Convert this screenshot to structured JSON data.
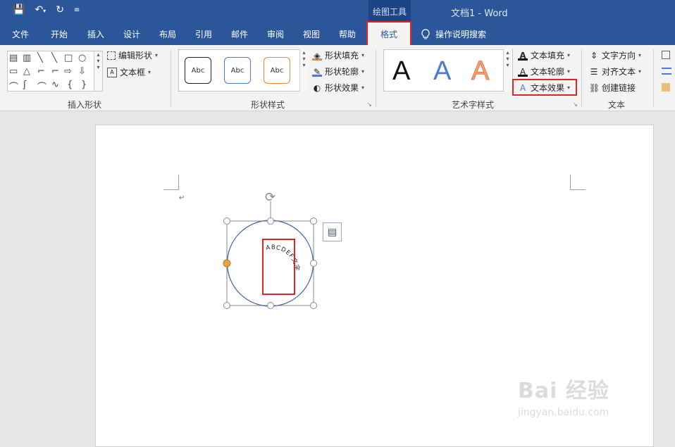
{
  "titlebar": {
    "context_label": "绘图工具",
    "doc_title": "文档1  -  Word",
    "qat": {
      "save": "💾",
      "undo": "↶",
      "undo_caret": "▾",
      "redo": "↻",
      "customize": "≡"
    }
  },
  "tabs": [
    "文件",
    "开始",
    "插入",
    "设计",
    "布局",
    "引用",
    "邮件",
    "审阅",
    "视图",
    "帮助"
  ],
  "active_tab": "格式",
  "search": {
    "label": "操作说明搜索"
  },
  "groups": {
    "insert_shapes": {
      "label": "插入形状",
      "edit_shape": "编辑形状",
      "text_box": "文本框"
    },
    "shape_styles": {
      "label": "形状样式",
      "fill": "形状填充",
      "outline": "形状轮廓",
      "effects": "形状效果",
      "samples": [
        "Abc",
        "Abc",
        "Abc"
      ]
    },
    "wordart_styles": {
      "label": "艺术字样式",
      "text_fill": "文本填充",
      "text_outline": "文本轮廓",
      "text_effects": "文本效果",
      "letters": [
        "A",
        "A",
        "A"
      ]
    },
    "text": {
      "label": "文本",
      "direction": "文字方向",
      "align": "对齐文本",
      "link": "创建链接"
    }
  },
  "shape_glyphs": [
    "▤",
    "▥",
    "╲",
    "╲",
    "□",
    "○",
    "▭",
    "△",
    "⌐",
    "⌐",
    "⇨",
    "⇩",
    "⌒",
    "ʃ",
    "⌒",
    "∿",
    "{",
    "}",
    "☆"
  ],
  "canvas": {
    "curved_text": "ABCDEF文字",
    "paragraph_mark": "↵",
    "rotate_glyph": "⟳",
    "layout_glyph": "▤"
  },
  "watermark": {
    "line1": "Bai 经验",
    "line2": "jingyan.baidu.com"
  },
  "colors": {
    "accent": "#2b579a",
    "highlight": "#e02424",
    "wordart_blue": "#4a7bd0",
    "wordart_orange": "#f2a27a"
  }
}
